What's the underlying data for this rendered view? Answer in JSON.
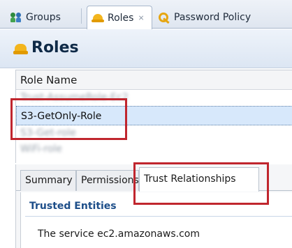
{
  "editor_tabs": [
    {
      "label": "Groups",
      "icon": "groups-icon",
      "active": false
    },
    {
      "label": "Roles",
      "icon": "role-hat-icon",
      "active": true,
      "close_glyph": "⨯"
    },
    {
      "label": "Password Policy",
      "icon": "key-icon",
      "active": false
    }
  ],
  "header": {
    "title": "Roles",
    "icon": "role-hat-icon"
  },
  "table": {
    "column_header": "Role Name",
    "rows": [
      {
        "label": "Trust-AssumeRole-Ec2",
        "blurred": true
      },
      {
        "label": "S3-GetOnly-Role",
        "blurred": false,
        "selected": true
      },
      {
        "label": "S3-Get-role",
        "blurred": true
      },
      {
        "label": "WiFi-role",
        "blurred": true
      }
    ]
  },
  "form_tabs": [
    {
      "label": "Summary",
      "active": false
    },
    {
      "label": "Permissions",
      "active": false
    },
    {
      "label": "Trust Relationships",
      "active": true
    }
  ],
  "trust_panel": {
    "section_title": "Trusted Entities",
    "service_text": "The service ec2.amazonaws.com"
  },
  "colors": {
    "annotation": "#c0262e",
    "selection": "#d7e8fb",
    "section_title": "#1d4e89"
  }
}
